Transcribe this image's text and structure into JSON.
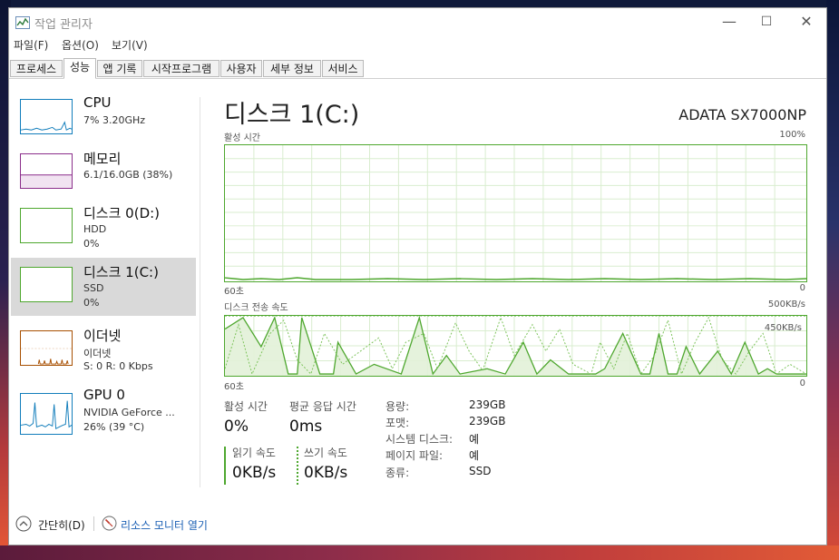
{
  "window": {
    "title": "작업 관리자",
    "controls": {
      "minimize": "—",
      "maximize": "☐",
      "close": "✕"
    }
  },
  "menu": [
    "파일(F)",
    "옵션(O)",
    "보기(V)"
  ],
  "tabs": [
    "프로세스",
    "성능",
    "앱 기록",
    "시작프로그램",
    "사용자",
    "세부 정보",
    "서비스"
  ],
  "active_tab": "성능",
  "sidebar": {
    "items": [
      {
        "name": "CPU",
        "line1": "7% 3.20GHz",
        "line2": ""
      },
      {
        "name": "메모리",
        "line1": "6.1/16.0GB (38%)",
        "line2": ""
      },
      {
        "name": "디스크 0(D:)",
        "line1": "HDD",
        "line2": "0%"
      },
      {
        "name": "디스크 1(C:)",
        "line1": "SSD",
        "line2": "0%"
      },
      {
        "name": "이더넷",
        "line1": "이더넷",
        "line2": "S: 0 R: 0 Kbps"
      },
      {
        "name": "GPU 0",
        "line1": "NVIDIA GeForce ...",
        "line2": "26% (39 °C)"
      }
    ],
    "active_index": 3
  },
  "detail": {
    "title": "디스크 1(C:)",
    "model": "ADATA SX7000NP",
    "chart1": {
      "label": "활성 시간",
      "max": "100%",
      "time": "60초",
      "min": "0"
    },
    "chart2": {
      "label": "디스크 전송 속도",
      "max": "500KB/s",
      "inner_max": "450KB/s",
      "time": "60초",
      "min": "0"
    },
    "stats": {
      "active_label": "활성 시간",
      "active_value": "0%",
      "response_label": "평균 응답 시간",
      "response_value": "0ms",
      "read_label": "읽기 속도",
      "read_value": "0KB/s",
      "write_label": "쓰기 속도",
      "write_value": "0KB/s"
    },
    "properties": [
      {
        "key": "용량:",
        "value": "239GB"
      },
      {
        "key": "포맷:",
        "value": "239GB"
      },
      {
        "key": "시스템 디스크:",
        "value": "예"
      },
      {
        "key": "페이지 파일:",
        "value": "예"
      },
      {
        "key": "종류:",
        "value": "SSD"
      }
    ]
  },
  "footer": {
    "fewer_details": "간단히(D)",
    "resource_monitor": "리소스 모니터 열기"
  },
  "colors": {
    "disk_green": "#4ea72e",
    "memory_purple": "#8b2e8b",
    "cpu_blue": "#117dbb",
    "ethernet_orange": "#a74f01"
  }
}
